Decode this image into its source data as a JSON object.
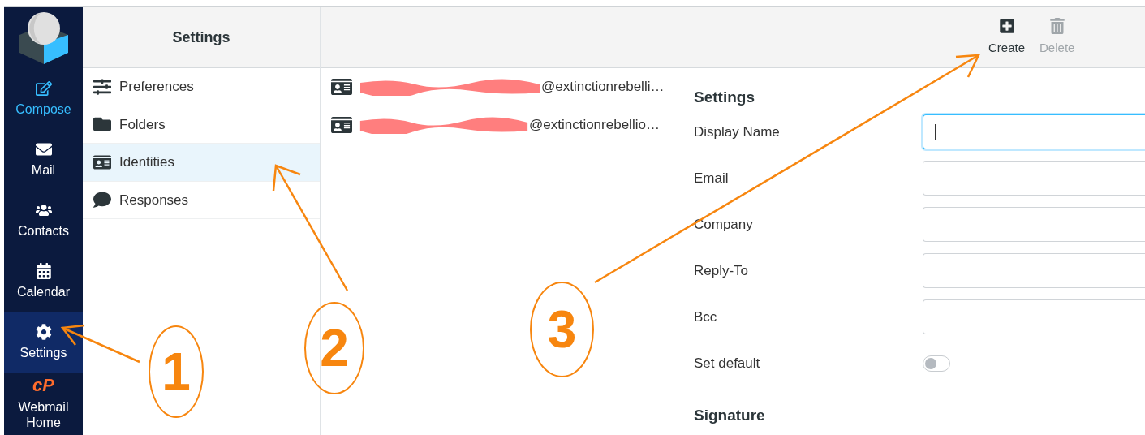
{
  "sidebar": {
    "items": [
      {
        "label": "Compose",
        "kind": "action",
        "selected": false
      },
      {
        "label": "Mail",
        "kind": "link",
        "selected": false
      },
      {
        "label": "Contacts",
        "kind": "link",
        "selected": false
      },
      {
        "label": "Calendar",
        "kind": "link",
        "selected": false
      },
      {
        "label": "Settings",
        "kind": "link",
        "selected": true
      },
      {
        "label": "Webmail Home",
        "kind": "cpanel",
        "logo_text": "cP",
        "selected": false
      }
    ]
  },
  "settings_menu": {
    "title": "Settings",
    "items": [
      {
        "label": "Preferences",
        "selected": false
      },
      {
        "label": "Folders",
        "selected": false
      },
      {
        "label": "Identities",
        "selected": true
      },
      {
        "label": "Responses",
        "selected": false
      }
    ]
  },
  "identities": [
    {
      "email": "@extinctionrebelli…",
      "redacted": true
    },
    {
      "email": "@extinctionrebellio…",
      "redacted": true
    }
  ],
  "toolbar": [
    {
      "label": "Create",
      "disabled": false
    },
    {
      "label": "Delete",
      "disabled": true
    }
  ],
  "form": {
    "sections": [
      {
        "title": "Settings",
        "fields": [
          {
            "label": "Display Name",
            "kind": "text",
            "focused": true
          },
          {
            "label": "Email",
            "kind": "text",
            "focused": false
          },
          {
            "label": "Company",
            "kind": "text",
            "focused": false
          },
          {
            "label": "Reply-To",
            "kind": "text",
            "focused": false
          },
          {
            "label": "Bcc",
            "kind": "text",
            "focused": false
          },
          {
            "label": "Set default",
            "kind": "toggle",
            "on": false
          }
        ]
      },
      {
        "title": "Signature"
      }
    ]
  },
  "annotations": [
    {
      "number": "1"
    },
    {
      "number": "2"
    },
    {
      "number": "3"
    }
  ]
}
